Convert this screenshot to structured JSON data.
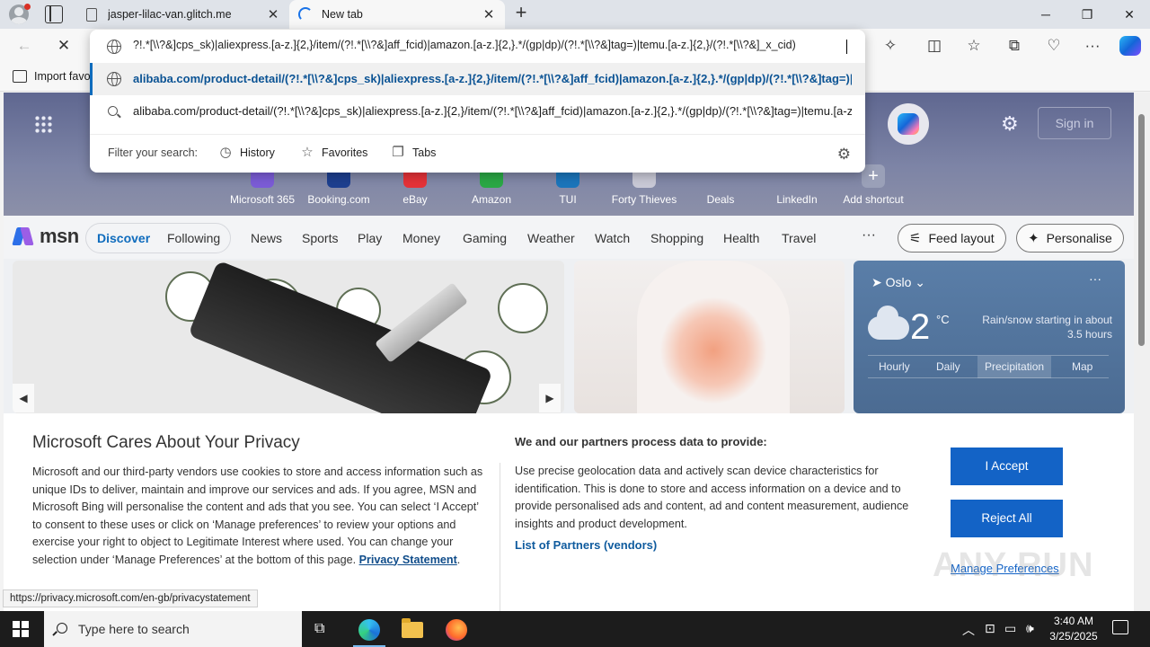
{
  "tabs": [
    {
      "title": "jasper-lilac-van.glitch.me",
      "close": "✕"
    },
    {
      "title": "New tab",
      "close": "✕"
    }
  ],
  "window_controls": {
    "minimize": "─",
    "maximize": "❐",
    "close": "✕"
  },
  "toolbar": {
    "back": "←",
    "stop": "✕",
    "more": "···"
  },
  "bookmarks": {
    "import_label": "Import favo"
  },
  "omnibox": {
    "input_value": "?!.*[\\\\?&]cps_sk)|aliexpress.[a-z.]{2,}/item/(?!.*[\\\\?&]aff_fcid)|amazon.[a-z.]{2,}.*/(gp|dp)/(?!.*[\\\\?&]tag=)|temu.[a-z.]{2,}/(?!.*[\\\\?&]_x_cid)",
    "suggestion_url": "alibaba.com/product-detail/(?!.*[\\\\?&]cps_sk)|aliexpress.[a-z.]{2,}/item/(?!.*[\\\\?&]aff_fcid)|amazon.[a-z.]{2,}.*/(gp|dp)/(?!.*[\\\\?&]tag=)|temu.[a-z.]{2,}/(?!.*[\\\\?&]_x_cid)",
    "suggestion_search": "alibaba.com/product-detail/(?!.*[\\\\?&]cps_sk)|aliexpress.[a-z.]{2,}/item/(?!.*[\\\\?&]aff_fcid)|amazon.[a-z.]{2,}.*/(gp|dp)/(?!.*[\\\\?&]tag=)|temu.[a-z.]{2,}/(?!.*[\\\\?&]_x_cid)",
    "filter_label": "Filter your search:",
    "filters": [
      "History",
      "Favorites",
      "Tabs"
    ]
  },
  "hero": {
    "signin": "Sign in",
    "shortcuts": [
      {
        "label": "Microsoft 365",
        "color": "#7b5cd6"
      },
      {
        "label": "Booking.com",
        "color": "#1d3f8f"
      },
      {
        "label": "eBay",
        "color": "#e53238"
      },
      {
        "label": "Amazon",
        "color": "#2aa845"
      },
      {
        "label": "TUI",
        "color": "#1b75bb"
      },
      {
        "label": "Forty Thieves",
        "color": "#c9c9d6"
      },
      {
        "label": "Deals",
        "color": "#8e8ea8"
      },
      {
        "label": "LinkedIn",
        "color": "#8e8ea8"
      },
      {
        "label": "Add shortcut",
        "color": "#9aa0b8"
      }
    ]
  },
  "msn": {
    "logo": "msn",
    "nav_primary": [
      "Discover",
      "Following"
    ],
    "nav": [
      "News",
      "Sports",
      "Play",
      "Money",
      "Gaming",
      "Weather",
      "Watch",
      "Shopping",
      "Health",
      "Travel"
    ],
    "more": "···",
    "feed_layout": "Feed layout",
    "personalise": "Personalise"
  },
  "weather": {
    "location": "Oslo",
    "temp": "2",
    "unit": "°C",
    "note": "Rain/snow starting in about 3.5 hours",
    "tabs": [
      "Hourly",
      "Daily",
      "Precipitation",
      "Map"
    ],
    "selected_tab": "Precipitation",
    "more": "···"
  },
  "privacy": {
    "title": "Microsoft Cares About Your Privacy",
    "body": "Microsoft and our third-party vendors use cookies to store and access information such as unique IDs to deliver, maintain and improve our services and ads. If you agree, MSN and Microsoft Bing will personalise the content and ads that you see. You can select ‘I Accept’ to consent to these uses or click on ‘Manage preferences’ to review your options and exercise your right to object to Legitimate Interest where used.  You can change your selection under ‘Manage Preferences’ at the bottom of this page.",
    "statement_link": "Privacy Statement",
    "subheading": "We and our partners process data to provide:",
    "body2": "Use precise geolocation data and actively scan device characteristics for identification. This is done to store and access information on a device and to provide personalised ads and content, ad and content measurement, audience insights and product development.",
    "partners_link": "List of Partners (vendors)",
    "accept": "I Accept",
    "reject": "Reject All",
    "manage": "Manage Preferences"
  },
  "status_url": "https://privacy.microsoft.com/en-gb/privacystatement",
  "watermark": "ANY RUN",
  "taskbar": {
    "search_placeholder": "Type here to search",
    "time": "3:40 AM",
    "date": "3/25/2025"
  }
}
